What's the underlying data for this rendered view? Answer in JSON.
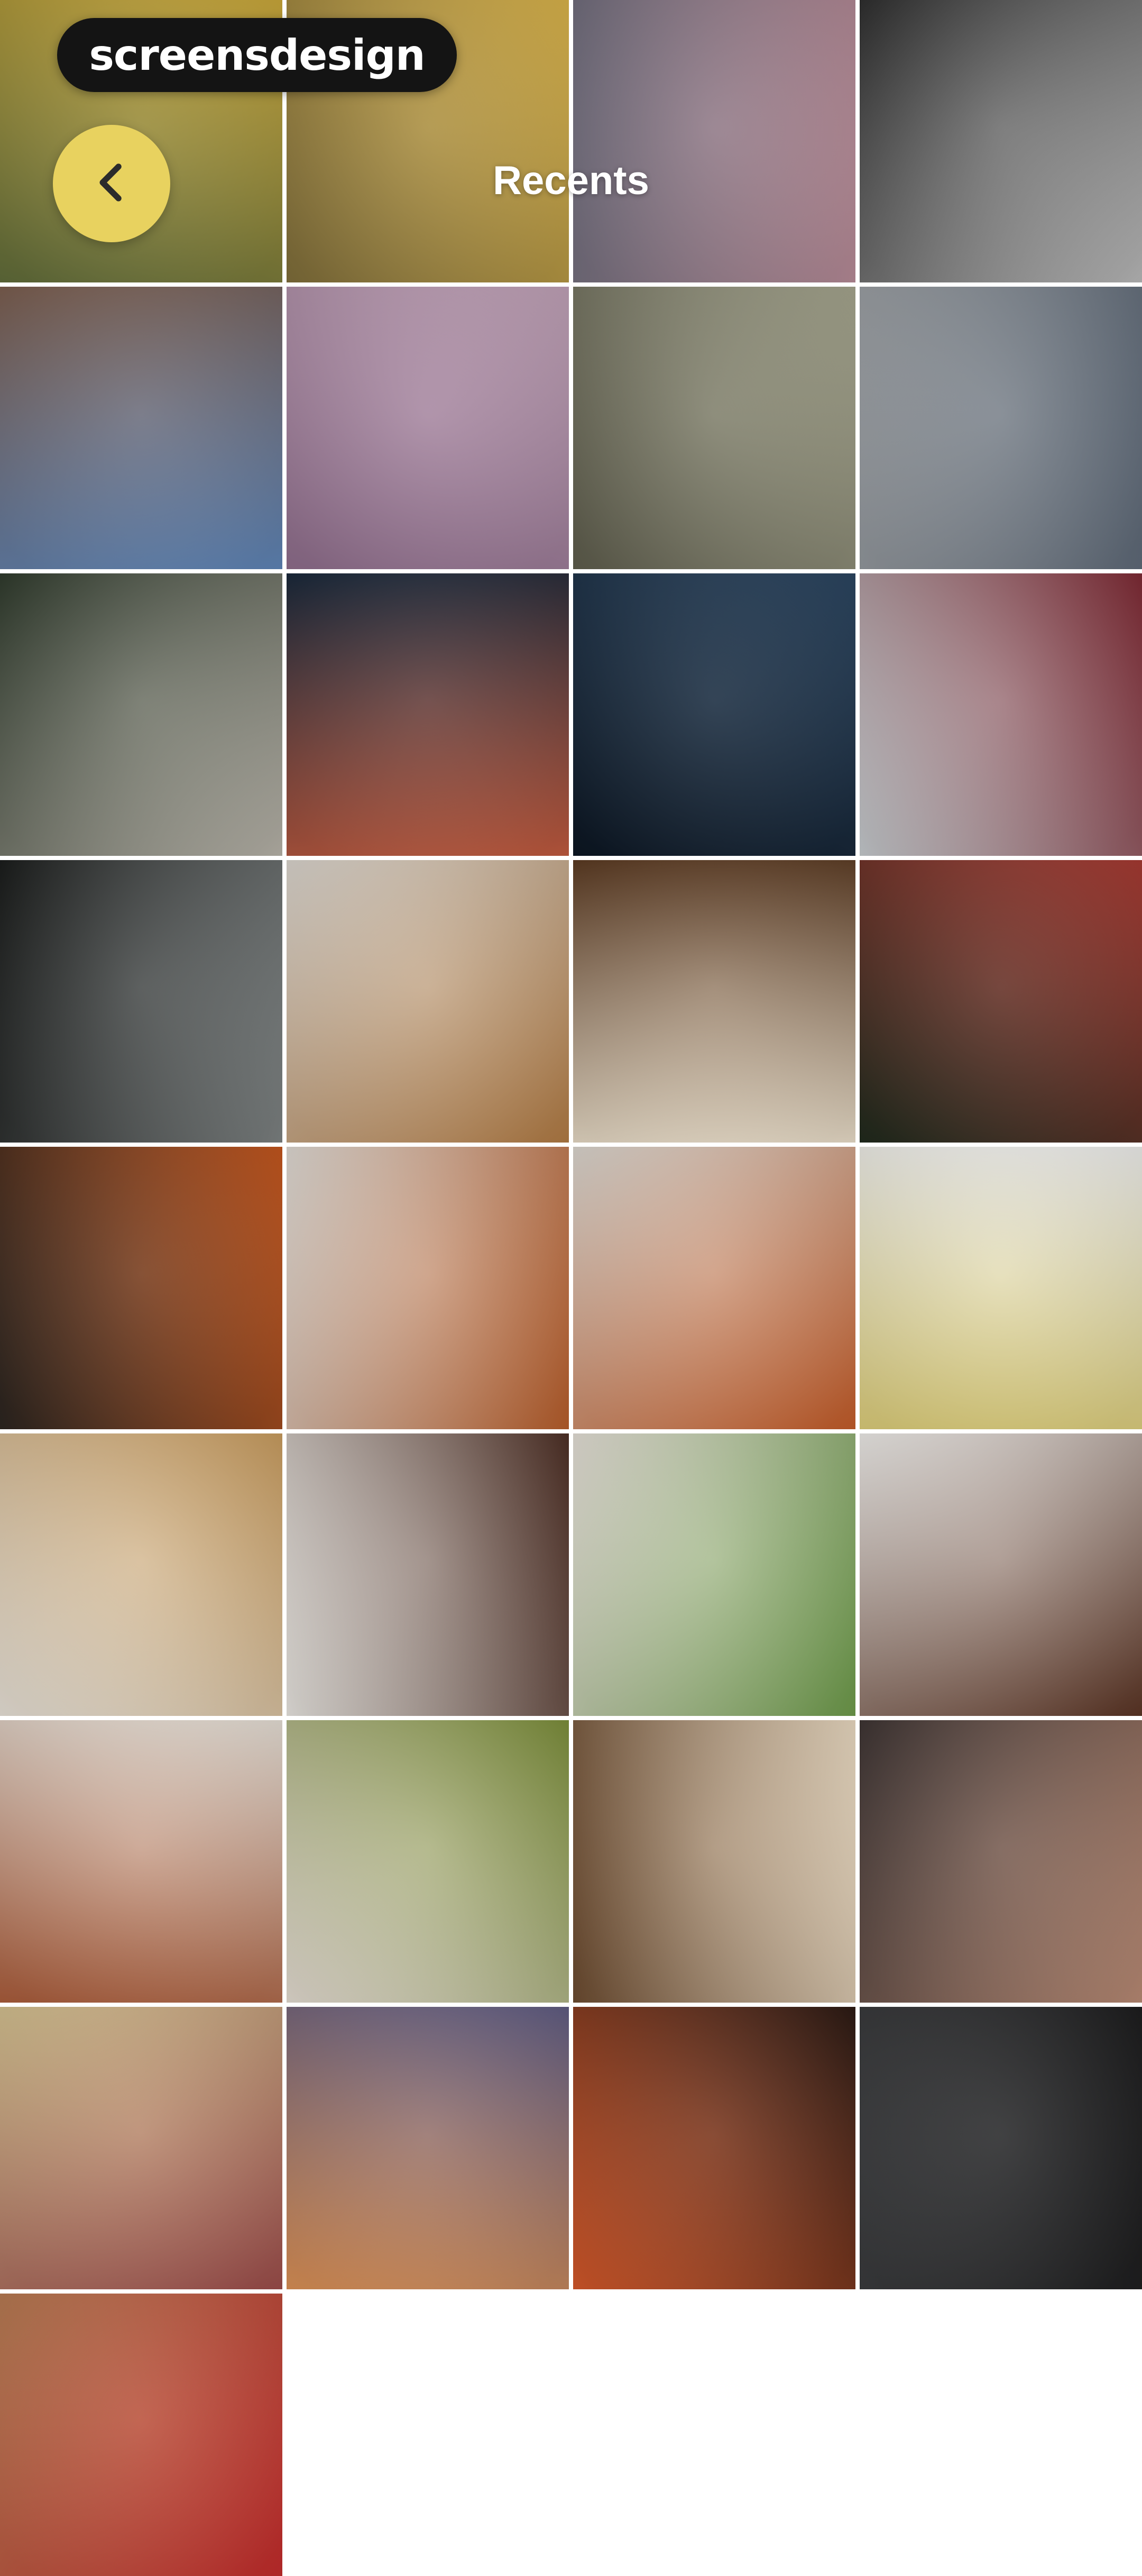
{
  "brand": {
    "text": "screensdesign"
  },
  "header": {
    "title": "Recents"
  },
  "icons": {
    "back": "chevron-left-icon"
  },
  "colors": {
    "back_button": "#e8d25f",
    "background": "#ffffff"
  },
  "photos": [
    {
      "alt": "woman in yellow jacket by water",
      "c1": "#5f6b3a",
      "c2": "#c9a73a"
    },
    {
      "alt": "woman in yellow coat",
      "c1": "#7d6c3a",
      "c2": "#d8b24a"
    },
    {
      "alt": "grey pink evening sky",
      "c1": "#6f6c7b",
      "c2": "#b58a96"
    },
    {
      "alt": "black and white portrait",
      "c1": "#2e2e2e",
      "c2": "#b8b8b8"
    },
    {
      "alt": "woman in denim jacket",
      "c1": "#7a5d4e",
      "c2": "#5e84b6"
    },
    {
      "alt": "pink sky with tree branches",
      "c1": "#8d6c8a",
      "c2": "#bfa1b6"
    },
    {
      "alt": "woman sitting on steps",
      "c1": "#5d5c4c",
      "c2": "#a4a48d"
    },
    {
      "alt": "woman sitting on stairs",
      "c1": "#9a9ea2",
      "c2": "#5e6977"
    },
    {
      "alt": "woman in sneakers sitting",
      "c1": "#2f3a2c",
      "c2": "#b7b3a9"
    },
    {
      "alt": "red moon over clouds",
      "c1": "#19283a",
      "c2": "#c05a3e"
    },
    {
      "alt": "dark night sky",
      "c1": "#0c1622",
      "c2": "#2b4560"
    },
    {
      "alt": "woman in red sweater",
      "c1": "#c4c9cc",
      "c2": "#7d2a34"
    },
    {
      "alt": "black sports car",
      "c1": "#1b1d1c",
      "c2": "#7d8282"
    },
    {
      "alt": "burgers on wooden board",
      "c1": "#d8d3cc",
      "c2": "#b07a43"
    },
    {
      "alt": "grilled fish plate",
      "c1": "#5a3a22",
      "c2": "#e8dcc8"
    },
    {
      "alt": "christmas tree ornaments",
      "c1": "#1f2a1d",
      "c2": "#a63a32"
    },
    {
      "alt": "tree bark with orange",
      "c1": "#2b2520",
      "c2": "#c3561e"
    },
    {
      "alt": "tray of fried bites",
      "c1": "#ddd8d2",
      "c2": "#b65d2b"
    },
    {
      "alt": "chicken wings bowl",
      "c1": "#d9d4cd",
      "c2": "#c25b28"
    },
    {
      "alt": "plated dessert",
      "c1": "#ececea",
      "c2": "#dacb78"
    },
    {
      "alt": "bamboo steamer dishes",
      "c1": "#e6e0d6",
      "c2": "#c79b5e"
    },
    {
      "alt": "meat with rice",
      "c1": "#e7e4df",
      "c2": "#4d2f25"
    },
    {
      "alt": "salad rolls on board",
      "c1": "#e2ddd5",
      "c2": "#6d9a4a"
    },
    {
      "alt": "sliced roast meat",
      "c1": "#ebe9e6",
      "c2": "#5a3424"
    },
    {
      "alt": "veggie wraps on board",
      "c1": "#e4ddd4",
      "c2": "#a85b3a"
    },
    {
      "alt": "burger with greens",
      "c1": "#e3dbd1",
      "c2": "#7b8d3a"
    },
    {
      "alt": "fish plate with lemon",
      "c1": "#6b4b30",
      "c2": "#e8d8c0"
    },
    {
      "alt": "two women smiling",
      "c1": "#3d3433",
      "c2": "#b88a74"
    },
    {
      "alt": "friends in living room",
      "c1": "#d2bf8f",
      "c2": "#9b4c4a"
    },
    {
      "alt": "purple sunset sky",
      "c1": "#5f5c82",
      "c2": "#d98f55"
    },
    {
      "alt": "silhouette at sunset",
      "c1": "#d3582a",
      "c2": "#2b1a14"
    },
    {
      "alt": "woman in black",
      "c1": "#3a3b3d",
      "c2": "#1d1d1e"
    },
    {
      "alt": "blonde woman in red",
      "c1": "#b57a52",
      "c2": "#c22b2b"
    }
  ]
}
